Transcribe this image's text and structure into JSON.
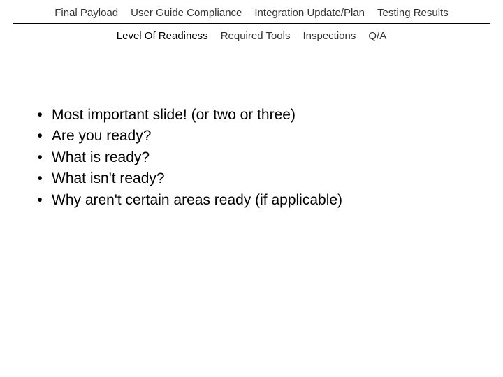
{
  "tabs_row1": [
    "Final Payload",
    "User Guide Compliance",
    "Integration Update/Plan",
    "Testing Results"
  ],
  "tabs_row2": [
    "Level Of Readiness",
    "Required Tools",
    "Inspections",
    "Q/A"
  ],
  "bullets": [
    "Most important slide! (or two or three)",
    "Are you ready?",
    "What is ready?",
    "What isn't ready?",
    "Why aren't certain areas ready (if applicable)"
  ],
  "active_tab_index_row2": 0
}
